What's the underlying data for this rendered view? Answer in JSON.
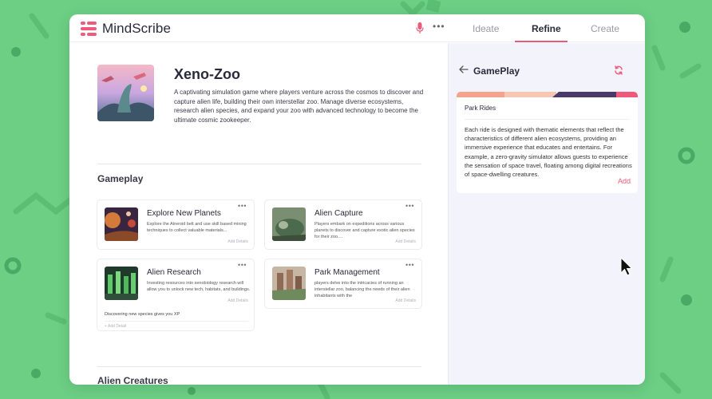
{
  "app": {
    "name": "MindScribe"
  },
  "tabs": [
    {
      "label": "Ideate"
    },
    {
      "label": "Refine"
    },
    {
      "label": "Create"
    }
  ],
  "active_tab": "Refine",
  "project": {
    "title": "Xeno-Zoo",
    "description": "A captivating simulation game where players venture across the cosmos to discover and capture alien life, building their own interstellar zoo. Manage diverse ecosystems, research alien species, and expand your zoo with advanced technology to become the ultimate cosmic zookeeper."
  },
  "sections": {
    "gameplay": "Gameplay",
    "creatures": "Alien Creatures"
  },
  "cards": [
    {
      "title": "Explore New Planets",
      "text": "Explore the Atreroid belt and use skill based mining techniques to collect valuable materials...",
      "add_label": "Add Details"
    },
    {
      "title": "Alien Capture",
      "text": "Players embark on expeditions across various planets to discover and capture exotic alien species for their zoo....",
      "add_label": "Add Details"
    },
    {
      "title": "Alien Research",
      "text": "Investing resources into xenobiology research will allow you to unlock new tech, habitats, and buildings.",
      "add_label": "Add Details",
      "extra_detail": "Discovering new species gives you XP",
      "add_detail_label": "+ Add Detail"
    },
    {
      "title": "Park Management",
      "text": "players delve into the intricacies of running an interstellar zoo, balancing the needs of their alien inhabitants with the",
      "add_label": "Add Details"
    }
  ],
  "side_panel": {
    "title": "GamePlay",
    "detail": {
      "title": "Park Rides",
      "text": "Each ride is designed with thematic elements that reflect the characteristics of different alien ecosystems, providing an immersive experience that educates and entertains. For example, a zero-gravity simulator allows guests to experience the sensation of space travel, floating among digital recreations of space-dwelling creatures.",
      "add_label": "Add"
    }
  },
  "colors": {
    "background": "#6ccf84",
    "accent": "#ee5a7a",
    "panel": "#f3f4fb"
  },
  "icons": [
    "logo-icon",
    "microphone-icon",
    "more-icon",
    "back-arrow-icon",
    "refresh-icon",
    "cursor-icon"
  ]
}
